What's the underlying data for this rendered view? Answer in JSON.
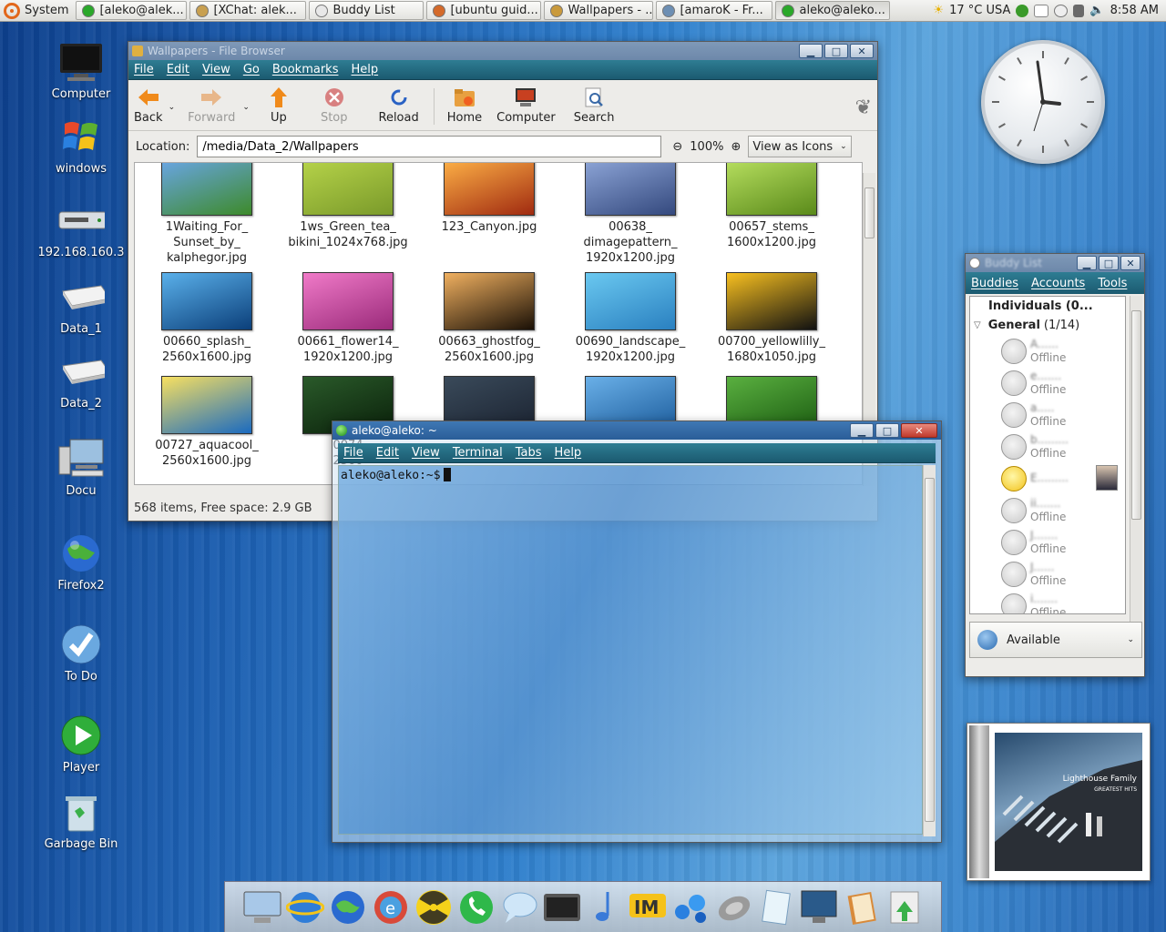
{
  "top_panel": {
    "system_label": "System",
    "tasks": [
      {
        "label": "[aleko@alek...",
        "color": "#2aa82a",
        "active": false
      },
      {
        "label": "[XChat: alek...",
        "color": "#c8a050",
        "active": false
      },
      {
        "label": "Buddy List",
        "color": "#e8e8e8",
        "active": false
      },
      {
        "label": "[ubuntu guid...",
        "color": "#d46a2a",
        "active": false
      },
      {
        "label": "Wallpapers - ...",
        "color": "#c99a3c",
        "active": false
      },
      {
        "label": "[amaroK - Fr...",
        "color": "#6d8fb3",
        "active": false
      },
      {
        "label": "aleko@aleko...",
        "color": "#2aa82a",
        "active": true
      }
    ],
    "weather": "17 °C USA",
    "clock": "8:58 AM"
  },
  "desktop_icons": [
    {
      "label": "Computer",
      "icon": "monitor-icon"
    },
    {
      "label": "windows",
      "icon": "windows-logo-icon"
    },
    {
      "label": "192.168.160.3",
      "icon": "network-drive-icon"
    },
    {
      "label": "Data_1",
      "icon": "drive-icon"
    },
    {
      "label": "Data_2",
      "icon": "drive-icon"
    },
    {
      "label": "Docu",
      "icon": "computer-icon"
    },
    {
      "label": "Firefox2",
      "icon": "globe-icon"
    },
    {
      "label": "To Do",
      "icon": "checkmark-icon"
    },
    {
      "label": "Player",
      "icon": "play-icon"
    },
    {
      "label": "Garbage Bin",
      "icon": "trash-icon"
    }
  ],
  "file_browser": {
    "title": "Wallpapers - File Browser",
    "menu": [
      "File",
      "Edit",
      "View",
      "Go",
      "Bookmarks",
      "Help"
    ],
    "toolbar": {
      "back": "Back",
      "forward": "Forward",
      "up": "Up",
      "stop": "Stop",
      "reload": "Reload",
      "home": "Home",
      "computer": "Computer",
      "search": "Search"
    },
    "location_label": "Location:",
    "location_value": "/media/Data_2/Wallpapers",
    "zoom": "100%",
    "view_mode": "View as Icons",
    "files": [
      {
        "name": "1Waiting_For_\nSunset_by_\nkalphegor.jpg",
        "colors": [
          "#6aa6e8",
          "#3d8a2a"
        ]
      },
      {
        "name": "1ws_Green_tea_\nbikini_1024x768.jpg",
        "colors": [
          "#b7d44a",
          "#7a9a2a"
        ]
      },
      {
        "name": "123_Canyon.jpg",
        "colors": [
          "#ffb347",
          "#a02a10"
        ]
      },
      {
        "name": "00638_\ndimagepattern_\n1920x1200.jpg",
        "colors": [
          "#8ea6d8",
          "#34497e"
        ]
      },
      {
        "name": "00657_stems_\n1600x1200.jpg",
        "colors": [
          "#b8e060",
          "#5a8a1a"
        ]
      },
      {
        "name": "00660_splash_\n2560x1600.jpg",
        "colors": [
          "#5ab0ea",
          "#0b3f7a"
        ]
      },
      {
        "name": "00661_flower14_\n1920x1200.jpg",
        "colors": [
          "#f07ac8",
          "#9a2a7a"
        ]
      },
      {
        "name": "00663_ghostfog_\n2560x1600.jpg",
        "colors": [
          "#f0b060",
          "#1a1006"
        ]
      },
      {
        "name": "00690_landscape_\n1920x1200.jpg",
        "colors": [
          "#6ac8f0",
          "#2a80c0"
        ]
      },
      {
        "name": "00700_yellowlilly_\n1680x1050.jpg",
        "colors": [
          "#f8c020",
          "#111111"
        ]
      },
      {
        "name": "00727_aquacool_\n2560x1600.jpg",
        "colors": [
          "#f8e060",
          "#1a6ac0"
        ]
      },
      {
        "name": "0074\n2560",
        "colors": [
          "#2a5a2a",
          "#0a200a"
        ]
      },
      {
        "name": "",
        "colors": [
          "#3a4a5a",
          "#1a2230"
        ]
      },
      {
        "name": "",
        "colors": [
          "#6ab0e8",
          "#1a5a9a"
        ]
      },
      {
        "name": "",
        "colors": [
          "#5ab040",
          "#1a5a10"
        ]
      }
    ],
    "status": "568 items, Free space: 2.9 GB"
  },
  "terminal": {
    "title": "aleko@aleko: ~",
    "menu": [
      "File",
      "Edit",
      "View",
      "Terminal",
      "Tabs",
      "Help"
    ],
    "prompt": "aleko@aleko:~$"
  },
  "buddy_list": {
    "title": "Buddy List",
    "tabs": [
      "Buddies",
      "Accounts",
      "Tools"
    ],
    "groups": [
      {
        "label": "Individuals (0..."
      },
      {
        "label": "General",
        "count": "(1/14)"
      }
    ],
    "buddies": [
      {
        "name": "A......",
        "status": "Offline",
        "online": false
      },
      {
        "name": "e.......",
        "status": "Offline",
        "online": false
      },
      {
        "name": "a.....",
        "status": "Offline",
        "online": false
      },
      {
        "name": "b.........",
        "status": "Offline",
        "online": false
      },
      {
        "name": "E.........",
        "status": "",
        "online": true
      },
      {
        "name": "ii.......",
        "status": "Offline",
        "online": false
      },
      {
        "name": "J.......",
        "status": "Offline",
        "online": false
      },
      {
        "name": "J......",
        "status": "Offline",
        "online": false
      },
      {
        "name": "i.......",
        "status": "Offline",
        "online": false
      }
    ],
    "presence": "Available"
  },
  "album": {
    "title": "Lighthouse Family",
    "subtitle": "GREATEST HITS"
  }
}
